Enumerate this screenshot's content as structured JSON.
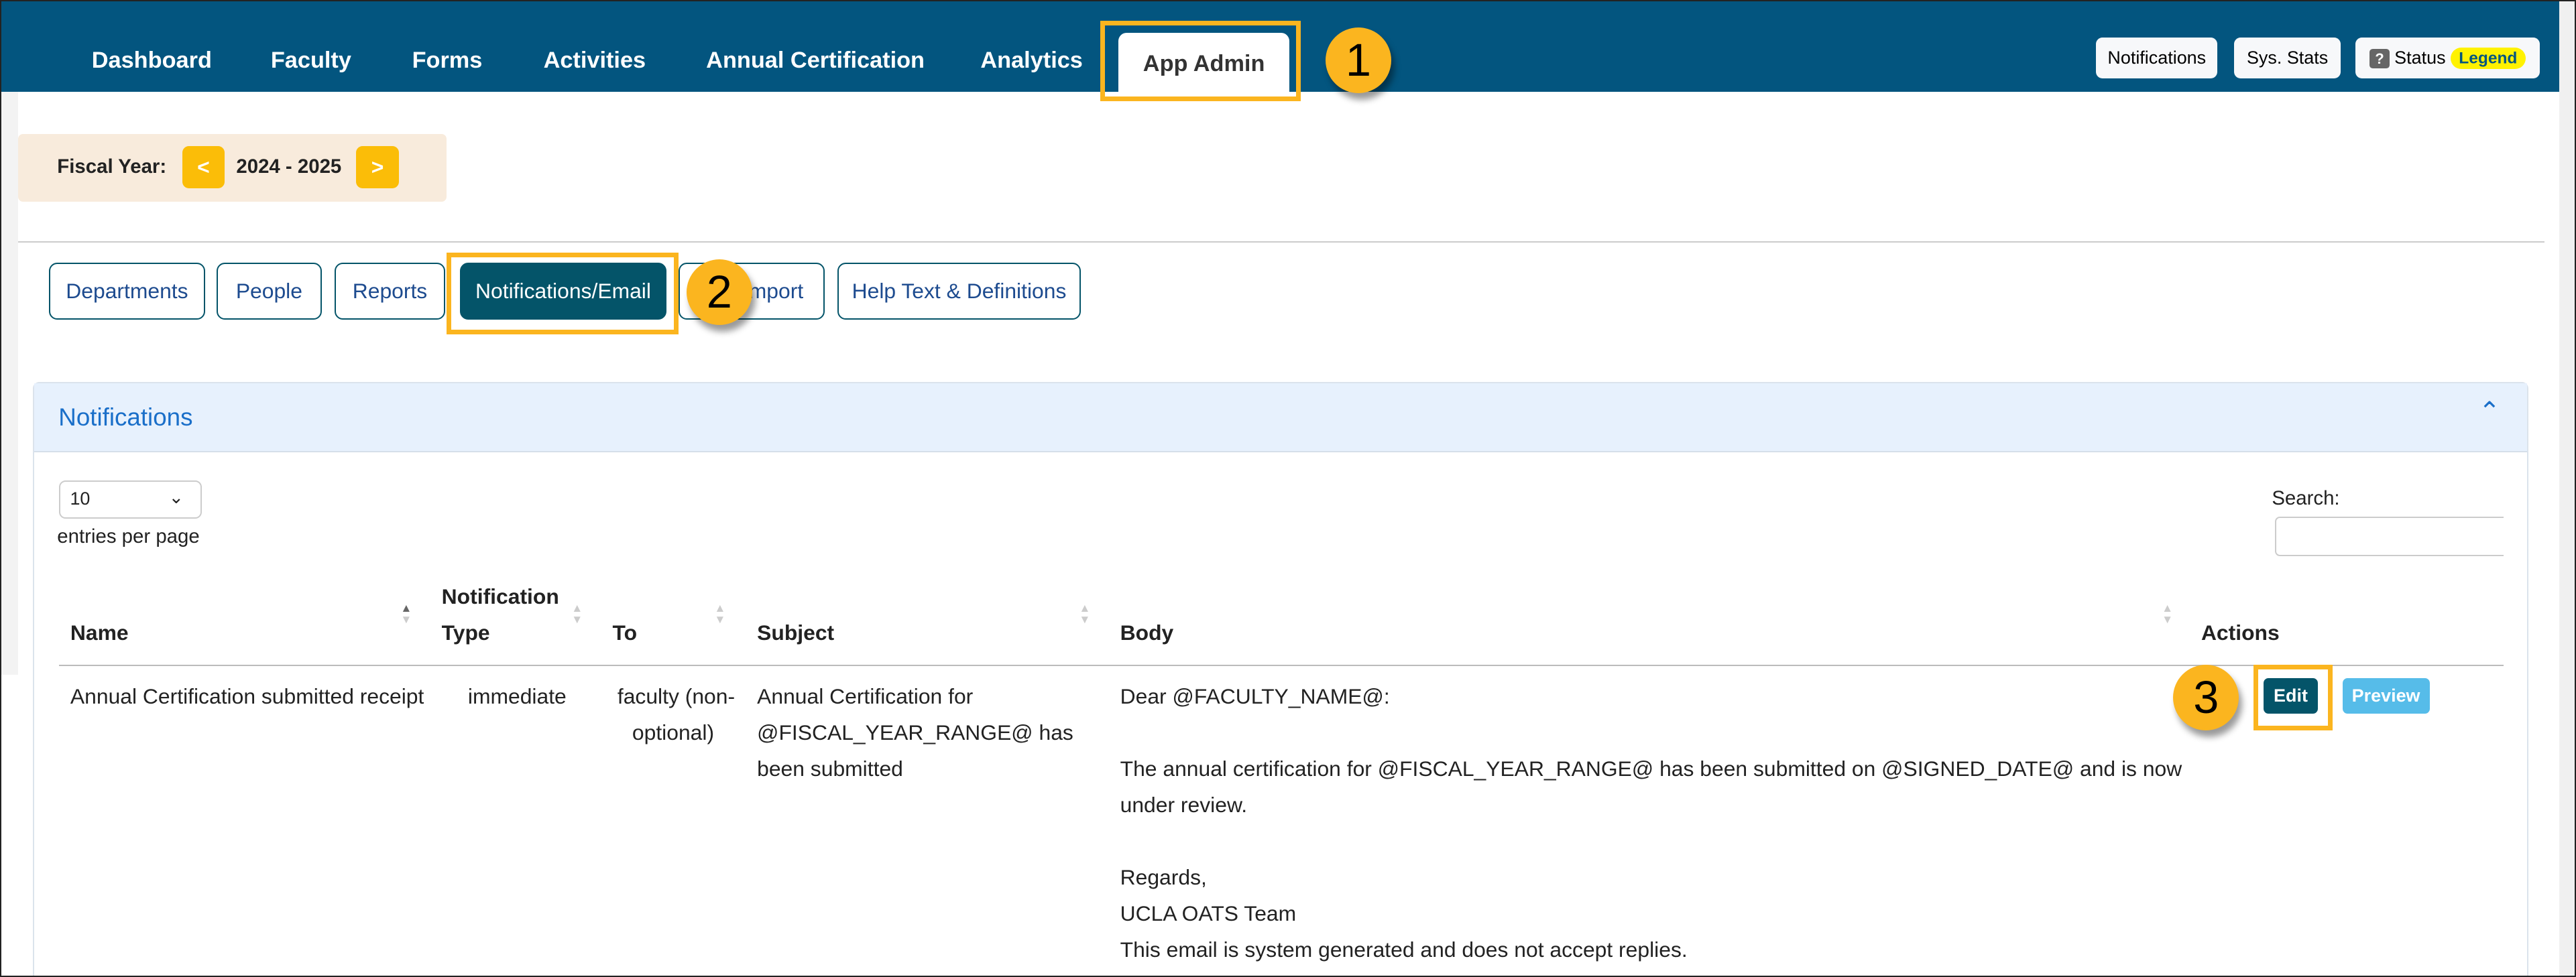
{
  "nav": {
    "items": [
      "Dashboard",
      "Faculty",
      "Forms",
      "Activities",
      "Annual Certification",
      "Analytics",
      "App Admin"
    ],
    "active": "App Admin",
    "notifications": "Notifications",
    "sys_stats": "Sys. Stats",
    "status": "Status",
    "legend": "Legend",
    "status_icon": "question-icon"
  },
  "fiscal_year": {
    "label": "Fiscal Year:",
    "value": "2024 - 2025",
    "prev": "<",
    "next": ">"
  },
  "tabs": [
    "Departments",
    "People",
    "Reports",
    "Notifications/Email",
    "Import",
    "Help Text & Definitions"
  ],
  "active_tab": "Notifications/Email",
  "card": {
    "title": "Notifications"
  },
  "length": {
    "value": "10",
    "label": "entries per page"
  },
  "search": {
    "label": "Search:",
    "value": ""
  },
  "table": {
    "headers": {
      "name": "Name",
      "type_1": "Notification",
      "type_2": "Type",
      "to": "To",
      "subject": "Subject",
      "body": "Body",
      "actions": "Actions"
    },
    "rows": [
      {
        "name": "Annual Certification submitted receipt",
        "type": "immediate",
        "to_1": "faculty (non-",
        "to_2": "optional)",
        "subject": [
          "Annual Certification for",
          "@FISCAL_YEAR_RANGE@ has",
          "been submitted"
        ],
        "body": [
          "Dear @FACULTY_NAME@:",
          "The annual certification for @FISCAL_YEAR_RANGE@ has been submitted on @SIGNED_DATE@ and is now",
          "under review.",
          "Regards,",
          "UCLA OATS Team",
          "This email is system generated and does not accept replies."
        ],
        "edit": "Edit",
        "preview": "Preview"
      }
    ]
  },
  "callouts": [
    "1",
    "2",
    "3"
  ],
  "colors": {
    "nav": "#03557f",
    "accent": "#fbb51f",
    "active_tab": "#045469",
    "preview": "#56bce9",
    "legend": "#fff200"
  }
}
